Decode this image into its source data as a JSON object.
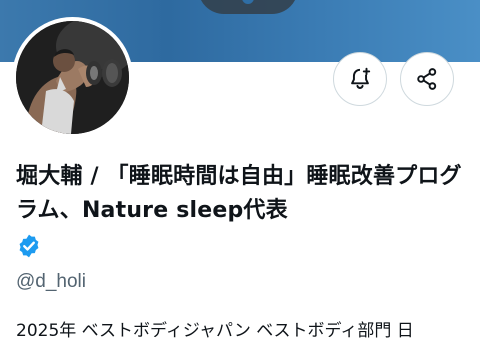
{
  "profile": {
    "name": "堀大輔 / 「睡眠時間は自由」睡眠改善プログラム、Nature sleep代表",
    "handle": "@d_holi",
    "bio": "2025年 ベストボディジャパン ベストボディ部門 日",
    "verified": true
  },
  "icons": {
    "notify": "bell-plus-icon",
    "share": "share-icon",
    "verified": "verified-badge-icon"
  },
  "colors": {
    "banner": "#3a7bb3",
    "verified_badge": "#1d9bf0",
    "text_primary": "#0f1419",
    "text_secondary": "#536471",
    "button_border": "#cfd9de"
  }
}
